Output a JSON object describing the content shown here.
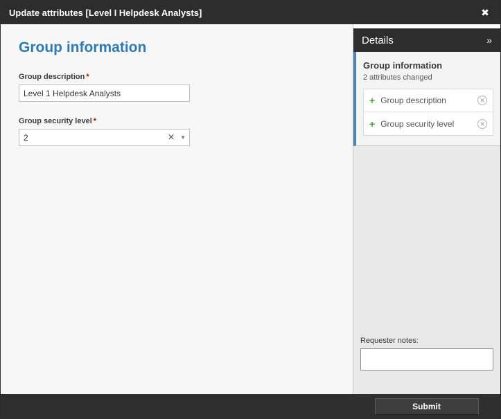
{
  "header": {
    "title": "Update attributes [Level I Helpdesk Analysts]",
    "close_glyph": "✖"
  },
  "main": {
    "heading": "Group information",
    "required_marker": "*",
    "fields": [
      {
        "label": "Group description",
        "value": "Level 1 Helpdesk Analysts"
      },
      {
        "label": "Group security level",
        "value": "2"
      }
    ],
    "combo": {
      "clear_glyph": "✕",
      "arrow_glyph": "▼"
    }
  },
  "sidebar": {
    "title": "Details",
    "collapse_glyph": "»",
    "section": {
      "title": "Group information",
      "subtitle": "2 attributes changed",
      "items": [
        {
          "plus_glyph": "+",
          "label": "Group description",
          "remove_glyph": "✕"
        },
        {
          "plus_glyph": "+",
          "label": "Group security level",
          "remove_glyph": "✕"
        }
      ]
    },
    "requester_notes_label": "Requester notes:",
    "requester_notes_value": ""
  },
  "footer": {
    "submit_label": "Submit"
  },
  "colors": {
    "titlebar_bg": "#2d2d2d",
    "heading_blue": "#2e7bb4",
    "accent_blue": "#4a85ad",
    "plus_green": "#3fae2a",
    "required_red": "#cc0000"
  }
}
